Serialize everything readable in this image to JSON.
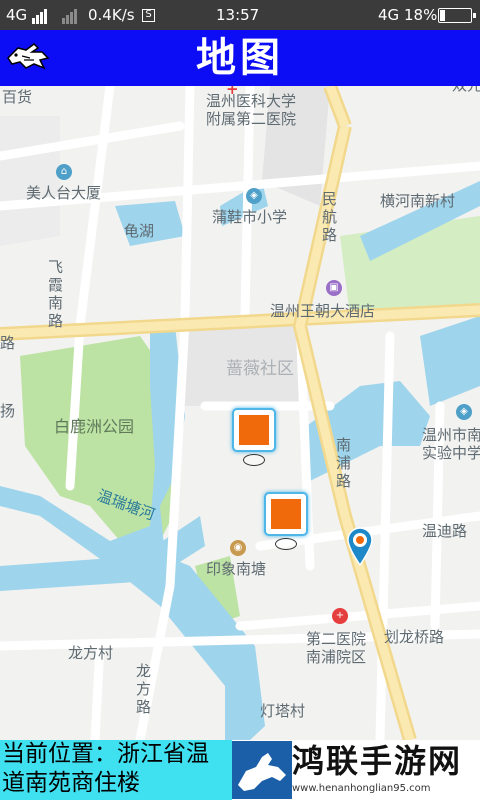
{
  "status_bar": {
    "network_left": "4G",
    "speed": "0.4K/s",
    "sim_icon": "S",
    "time": "13:57",
    "network_right": "4G",
    "battery": "18%",
    "battery_level": 0.18
  },
  "header": {
    "title": "地图",
    "back_icon": "pigeon-back-icon"
  },
  "map": {
    "labels": {
      "baihuo": "百货",
      "hospital_2": "温州医科大学\n附属第二医院",
      "hengh": "横河南新村",
      "mrtds": "美人台大厦",
      "pxsxx": "蒲鞋市小学",
      "minhang": "民航路",
      "guihu": "龟湖",
      "feixia": "飞霞南路",
      "wanghotel": "温州王朝大酒店",
      "lu_left": "路",
      "qiangwei": "蔷薇社区",
      "bailuzhou": "白鹿洲公园",
      "yang": "扬",
      "wzsn": "温州市南",
      "syz": "实验中学",
      "nanpu": "南浦路",
      "wenruitang": "温瑞塘河",
      "wendi": "温迪路",
      "yinxiang": "印象南塘",
      "second_hosp": "第二医院\n南浦院区",
      "hualong": "划龙桥路",
      "longfangcun": "龙方村",
      "longfanglu": "龙方路",
      "dengta": "灯塔村",
      "shuanglian": "双元"
    },
    "markers": [
      "poi-marker",
      "poi-marker"
    ],
    "location_pin": "location-pin-icon"
  },
  "location": {
    "line1": "当前位置：浙江省温",
    "line2": "道南苑商住楼"
  },
  "watermark": {
    "name": "鸿联手游网",
    "url": "www.henanhonglian95.com",
    "logo": "dog-logo-icon"
  }
}
